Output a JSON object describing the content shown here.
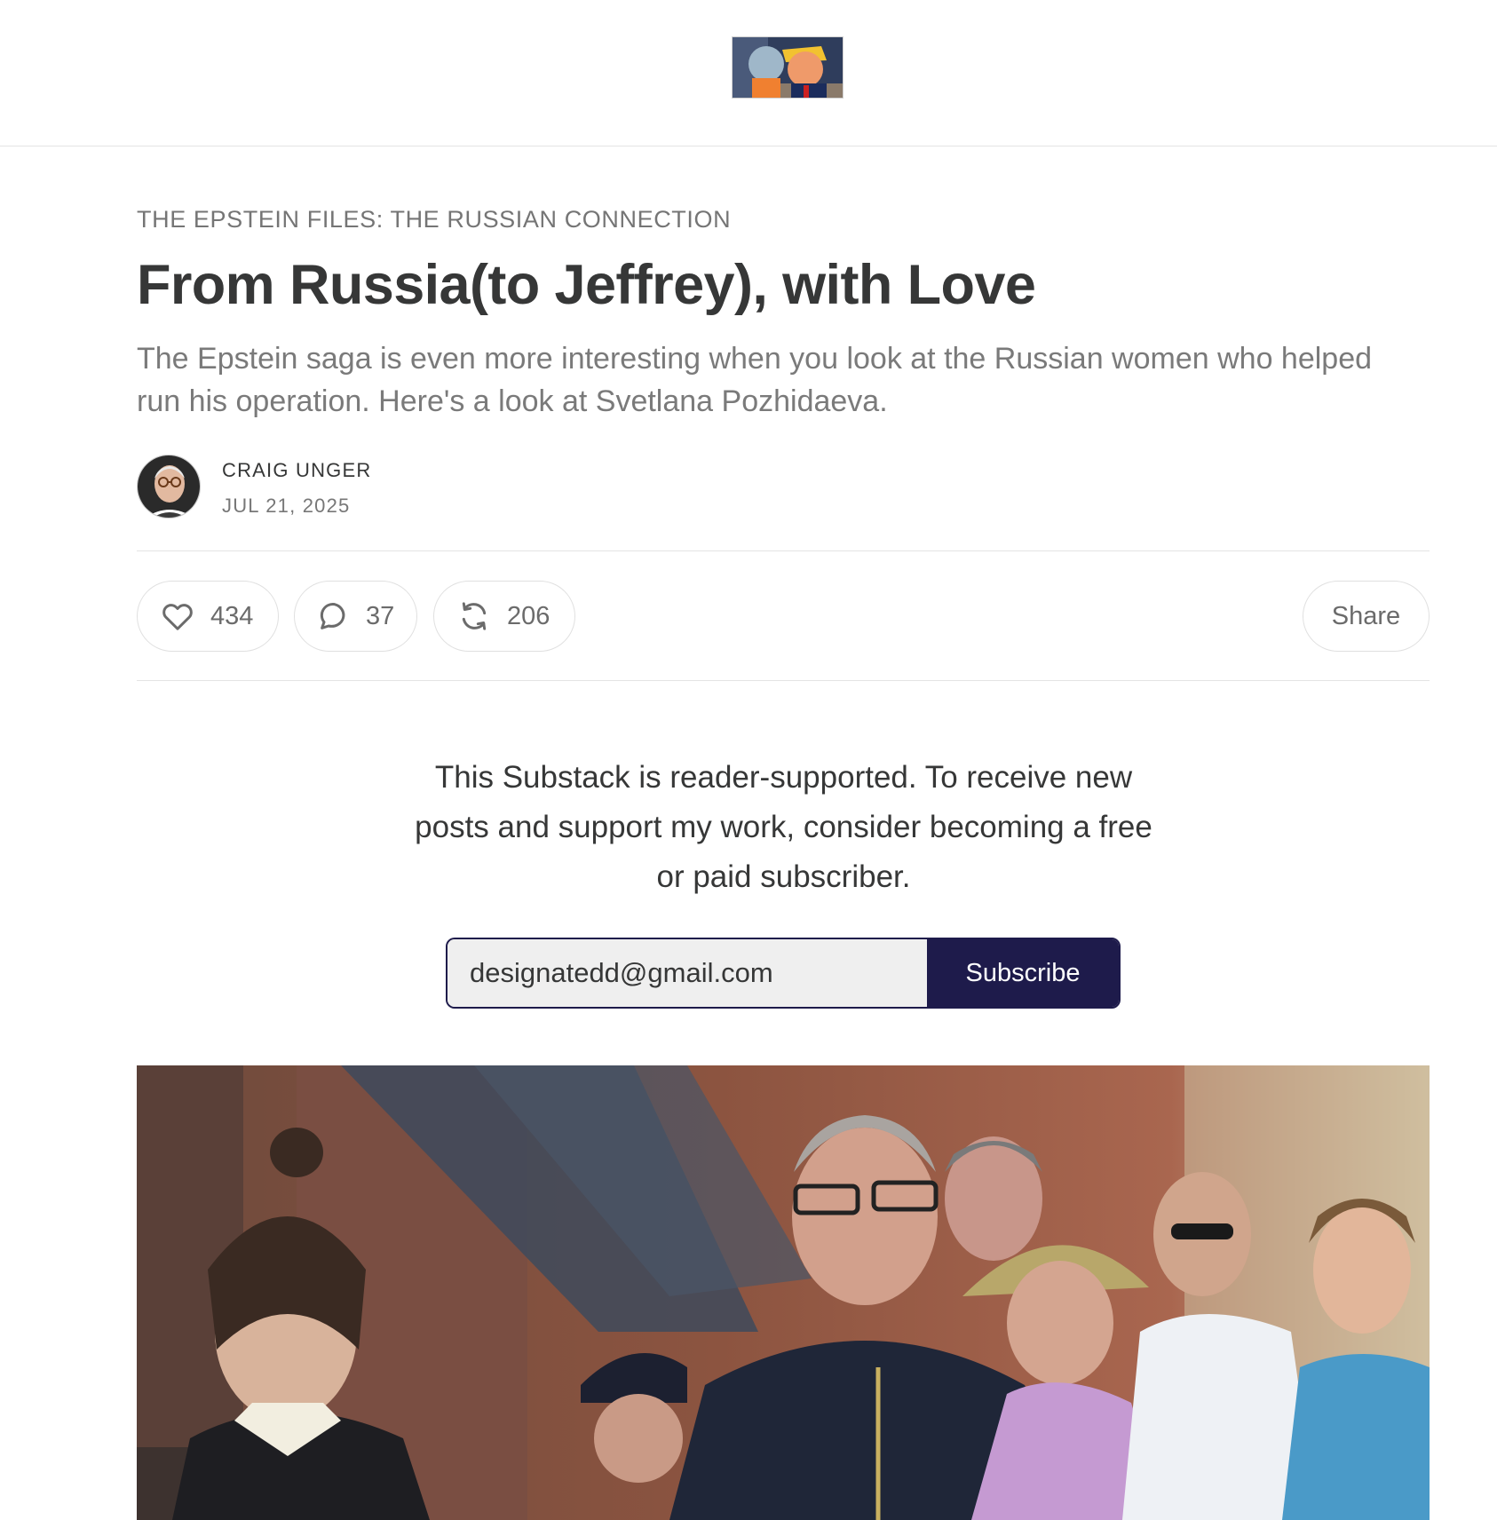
{
  "header": {
    "logo_icon": "publication-logo-image"
  },
  "post": {
    "section": "THE EPSTEIN FILES: THE RUSSIAN CONNECTION",
    "title": "From Russia(to Jeffrey), with Love",
    "subtitle": "The Epstein saga is even more interesting when you look at the Russian women who helped run his operation. Here's a look at Svetlana Pozhidaeva.",
    "author": "CRAIG UNGER",
    "date": "JUL 21, 2025"
  },
  "actions": {
    "likes": "434",
    "comments": "37",
    "restacks": "206",
    "share_label": "Share",
    "like_icon": "heart-icon",
    "comment_icon": "speech-bubble-icon",
    "restack_icon": "restack-arrows-icon"
  },
  "subscribe": {
    "message": "This Substack is reader-supported. To receive new posts and support my work, consider becoming a free or paid subscriber.",
    "email_value": "designatedd@gmail.com",
    "button_label": "Subscribe",
    "button_color": "#1e1b4b"
  },
  "hero_image": {
    "icon": "article-hero-photo"
  }
}
